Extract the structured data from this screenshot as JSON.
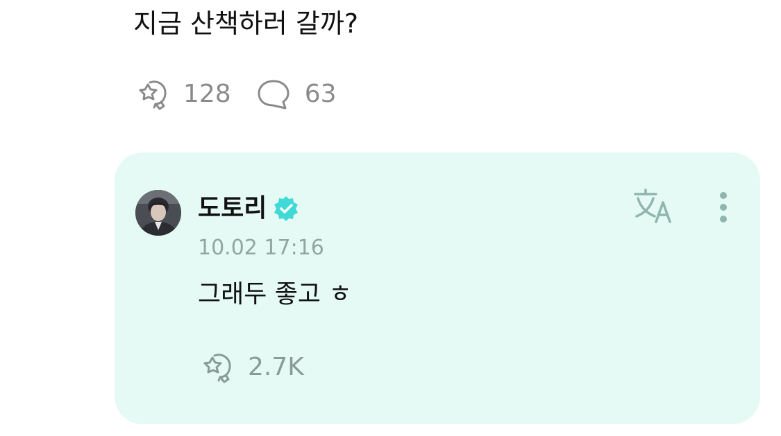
{
  "post": {
    "text": "지금 산책하러 갈까?",
    "cheer_count": "128",
    "comment_count": "63",
    "icons": {
      "cheer": "cheer-icon",
      "comment": "comment-bubble-icon"
    }
  },
  "comment": {
    "author_name": "도토리",
    "verified": true,
    "timestamp": "10.02 17:16",
    "text": "그래두 좋고 ㅎ",
    "cheer_count": "2.7K",
    "icons": {
      "translate": "translate-icon",
      "more": "more-vertical-icon",
      "verified": "verified-badge-icon",
      "cheer": "cheer-icon"
    }
  },
  "colors": {
    "card_background": "#e6faf5",
    "verified_badge": "#3fd9d6",
    "muted_text": "#8a8a8a",
    "timestamp": "#8fa6a1",
    "icon_teal": "#8fb5ae"
  }
}
